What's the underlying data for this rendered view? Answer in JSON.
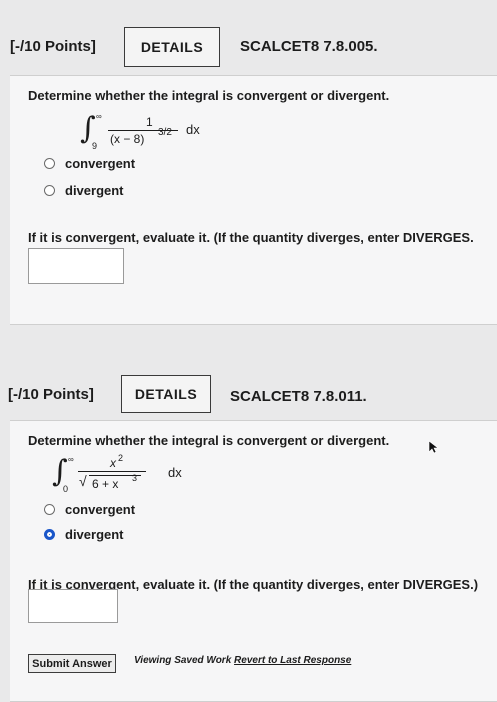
{
  "q1": {
    "points": "[-/10 Points]",
    "details_label": "DETAILS",
    "code": "SCALCET8 7.8.005.",
    "question": "Determine whether the integral is convergent or divergent.",
    "integral": {
      "lower": "9",
      "upper": "∞",
      "numerator": "1",
      "denominator": "(x − 8)",
      "exponent": "3/2",
      "dx": "dx"
    },
    "options": [
      "convergent",
      "divergent"
    ],
    "selected": null,
    "evaluate_prompt": "If it is convergent, evaluate it. (If the quantity diverges, enter DIVERGES.",
    "answer_value": ""
  },
  "q2": {
    "points": "[-/10 Points]",
    "details_label": "DETAILS",
    "code": "SCALCET8 7.8.011.",
    "question": "Determine whether the integral is convergent or divergent.",
    "integral": {
      "lower": "0",
      "upper": "∞",
      "numerator": "x",
      "numerator_exp": "2",
      "radicand": "6 + x",
      "radicand_exp": "3",
      "dx": "dx"
    },
    "options": [
      "convergent",
      "divergent"
    ],
    "selected": "divergent",
    "evaluate_prompt": "If it is convergent, evaluate it. (If the quantity diverges, enter DIVERGES.)",
    "answer_value": ""
  },
  "footer": {
    "submit_label": "Submit Answer",
    "saved_prefix": "Viewing Saved Work",
    "revert_link": "Revert to Last Response"
  }
}
